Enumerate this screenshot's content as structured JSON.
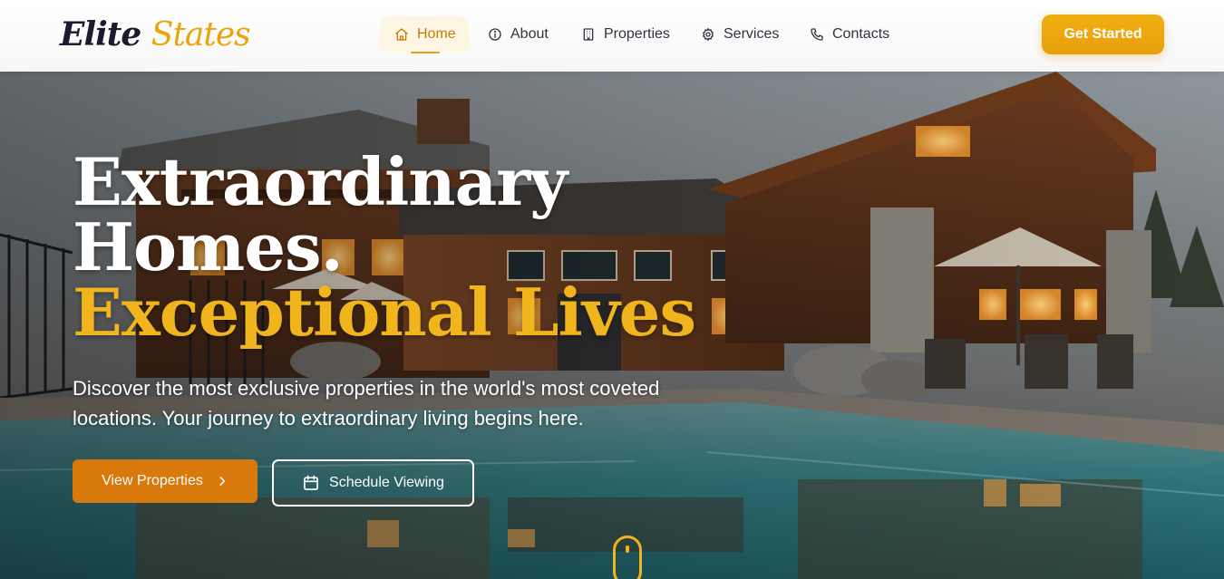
{
  "brand": {
    "word1": "Elite",
    "word2": "States",
    "color_dark": "#1c1a2e",
    "color_accent": "#e9a40c"
  },
  "nav": {
    "items": [
      {
        "label": "Home",
        "icon": "home-icon",
        "active": true
      },
      {
        "label": "About",
        "icon": "info-icon",
        "active": false
      },
      {
        "label": "Properties",
        "icon": "building-icon",
        "active": false
      },
      {
        "label": "Services",
        "icon": "gear-icon",
        "active": false
      },
      {
        "label": "Contacts",
        "icon": "phone-icon",
        "active": false
      }
    ],
    "cta_label": "Get Started",
    "active_color": "#c57a06"
  },
  "hero": {
    "headline_line1": "Extraordinary",
    "headline_line2": "Homes.",
    "headline_line3": "Exceptional Lives",
    "subtext": "Discover the most exclusive properties in the world's most coveted locations. Your journey to extraordinary living begins here.",
    "primary_button": {
      "label": "View Properties",
      "icon": "chevron-right-icon"
    },
    "secondary_button": {
      "label": "Schedule Viewing",
      "icon": "calendar-icon"
    },
    "accent_color": "#f0b41c",
    "primary_color": "#d9790c",
    "scroll_indicator": "mouse-scroll-icon"
  }
}
